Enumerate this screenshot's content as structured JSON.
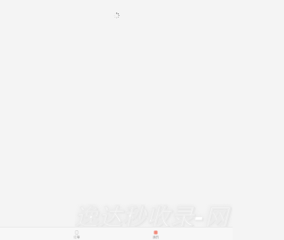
{
  "loading": {
    "icon": "loading-spinner-icon"
  },
  "tab_bar": {
    "items": [
      {
        "label": "订单",
        "icon": "orders-icon"
      },
      {
        "label": "我的",
        "icon": "user-icon"
      }
    ]
  },
  "watermark": {
    "text": "逸达秒收录-网"
  },
  "colors": {
    "background": "#f4f4f4",
    "tab_text": "#9a9a9a",
    "tab_active_icon": "#f08a7a"
  }
}
